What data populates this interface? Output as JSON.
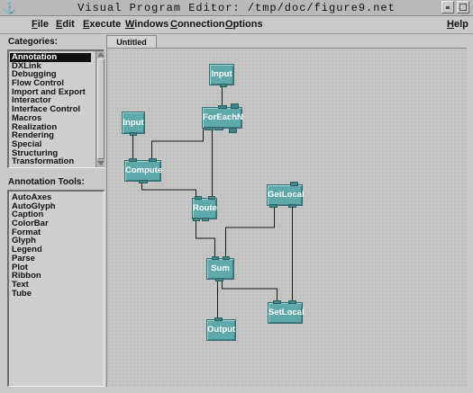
{
  "window": {
    "title": "Visual Program Editor: /tmp/doc/figure9.net"
  },
  "menubar": {
    "items": [
      "File",
      "Edit",
      "Execute",
      "Windows",
      "Connection",
      "Options"
    ],
    "help": "Help"
  },
  "categories": {
    "label": "Categories:",
    "selected": "Annotation",
    "items": [
      "Annotation",
      "DXLink",
      "Debugging",
      "Flow Control",
      "Import and Export",
      "Interactor",
      "Interface Control",
      "Macros",
      "Realization",
      "Rendering",
      "Special",
      "Structuring",
      "Transformation"
    ]
  },
  "tools": {
    "label": "Annotation Tools:",
    "items": [
      "AutoAxes",
      "AutoGlyph",
      "Caption",
      "ColorBar",
      "Format",
      "Glyph",
      "Legend",
      "Parse",
      "Plot",
      "Ribbon",
      "Text",
      "Tube"
    ]
  },
  "canvas": {
    "tab": "Untitled"
  },
  "nodes": {
    "input1": "Input",
    "foreachn": "ForEachN",
    "input2": "Input",
    "compute": "Compute",
    "route": "Route",
    "getlocal": "GetLocal",
    "sum": "Sum",
    "setlocal": "SetLocal",
    "output": "Output"
  },
  "colors": {
    "node": "#5fa9ab",
    "canvas": "#c5c5c5",
    "selection": "#111111"
  }
}
